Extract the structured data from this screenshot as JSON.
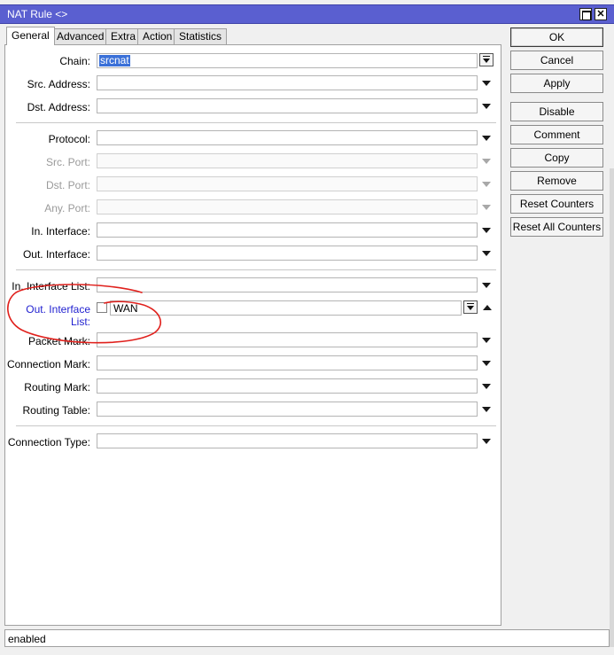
{
  "window": {
    "title": "NAT Rule <>"
  },
  "tabs": [
    {
      "label": "General",
      "active": true
    },
    {
      "label": "Advanced",
      "active": false
    },
    {
      "label": "Extra",
      "active": false
    },
    {
      "label": "Action",
      "active": false
    },
    {
      "label": "Statistics",
      "active": false
    }
  ],
  "fields": {
    "chain": {
      "label": "Chain:",
      "value": "srcnat"
    },
    "src_address": {
      "label": "Src. Address:",
      "value": ""
    },
    "dst_address": {
      "label": "Dst. Address:",
      "value": ""
    },
    "protocol": {
      "label": "Protocol:",
      "value": ""
    },
    "src_port": {
      "label": "Src. Port:",
      "value": ""
    },
    "dst_port": {
      "label": "Dst. Port:",
      "value": ""
    },
    "any_port": {
      "label": "Any. Port:",
      "value": ""
    },
    "in_interface": {
      "label": "In. Interface:",
      "value": ""
    },
    "out_interface": {
      "label": "Out. Interface:",
      "value": ""
    },
    "in_interface_list": {
      "label": "In. Interface List:",
      "value": ""
    },
    "out_interface_list": {
      "label": "Out. Interface List:",
      "value": "WAN",
      "negate": false
    },
    "packet_mark": {
      "label": "Packet Mark:",
      "value": ""
    },
    "connection_mark": {
      "label": "Connection Mark:",
      "value": ""
    },
    "routing_mark": {
      "label": "Routing Mark:",
      "value": ""
    },
    "routing_table": {
      "label": "Routing Table:",
      "value": ""
    },
    "connection_type": {
      "label": "Connection Type:",
      "value": ""
    }
  },
  "buttons": {
    "ok": "OK",
    "cancel": "Cancel",
    "apply": "Apply",
    "disable": "Disable",
    "comment": "Comment",
    "copy": "Copy",
    "remove": "Remove",
    "reset_counters": "Reset Counters",
    "reset_all_counters": "Reset All Counters"
  },
  "status": {
    "text": "enabled"
  },
  "colors": {
    "titlebar": "#5a5fd0",
    "highlight_label": "#1f1fd0",
    "selection": "#3a70d8",
    "annotation": "#e0201c"
  }
}
